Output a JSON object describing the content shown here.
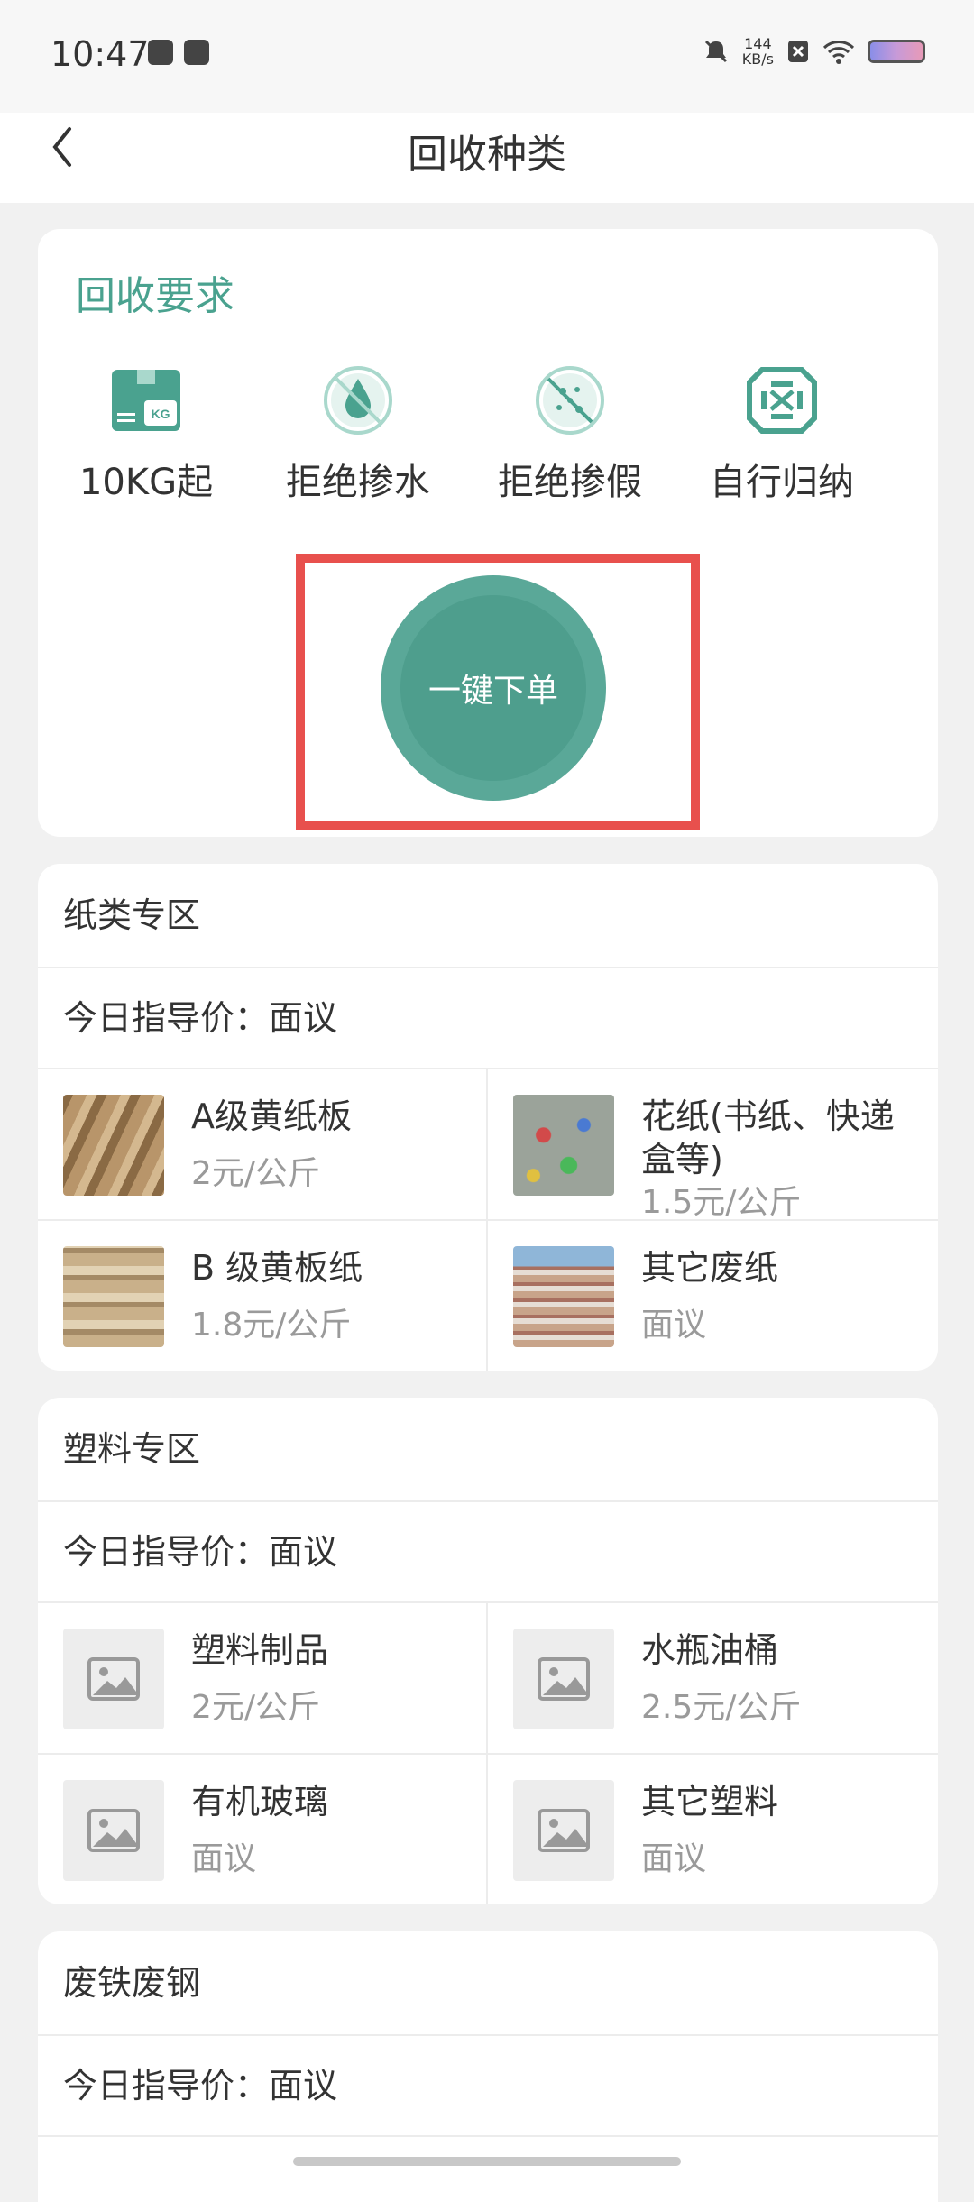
{
  "status_bar": {
    "time": "10:47",
    "net_speed_value": "144",
    "net_speed_unit": "KB/s"
  },
  "header": {
    "title": "回收种类"
  },
  "requirements": {
    "title": "回收要求",
    "items": [
      {
        "label": "10KG起",
        "icon": "weight-box-icon"
      },
      {
        "label": "拒绝掺水",
        "icon": "no-water-icon"
      },
      {
        "label": "拒绝掺假",
        "icon": "no-fake-icon"
      },
      {
        "label": "自行归纳",
        "icon": "recycle-icon"
      }
    ],
    "order_button": "一键下单"
  },
  "sections": [
    {
      "title": "纸类专区",
      "price_label": "今日指导价：面议",
      "items": [
        {
          "name": "A级黄纸板",
          "price": "2元/公斤",
          "image": "cardboard-photo"
        },
        {
          "name": "花纸(书纸、快递盒等)",
          "price": "1.5元/公斤",
          "image": "mixed-paper-photo"
        },
        {
          "name": "B 级黄板纸",
          "price": "1.8元/公斤",
          "image": "paper-bales-photo"
        },
        {
          "name": "其它废纸",
          "price": "面议",
          "image": "paper-stack-photo"
        }
      ]
    },
    {
      "title": "塑料专区",
      "price_label": "今日指导价：面议",
      "items": [
        {
          "name": "塑料制品",
          "price": "2元/公斤",
          "image": "image-placeholder-icon"
        },
        {
          "name": "水瓶油桶",
          "price": "2.5元/公斤",
          "image": "image-placeholder-icon"
        },
        {
          "name": "有机玻璃",
          "price": "面议",
          "image": "image-placeholder-icon"
        },
        {
          "name": "其它塑料",
          "price": "面议",
          "image": "image-placeholder-icon"
        }
      ]
    },
    {
      "title": "废铁废钢",
      "price_label": "今日指导价：面议",
      "items": []
    }
  ],
  "colors": {
    "accent": "#4aa28f",
    "button": "#5aa898",
    "highlight_border": "#e8504d",
    "background": "#f1f1f1"
  }
}
